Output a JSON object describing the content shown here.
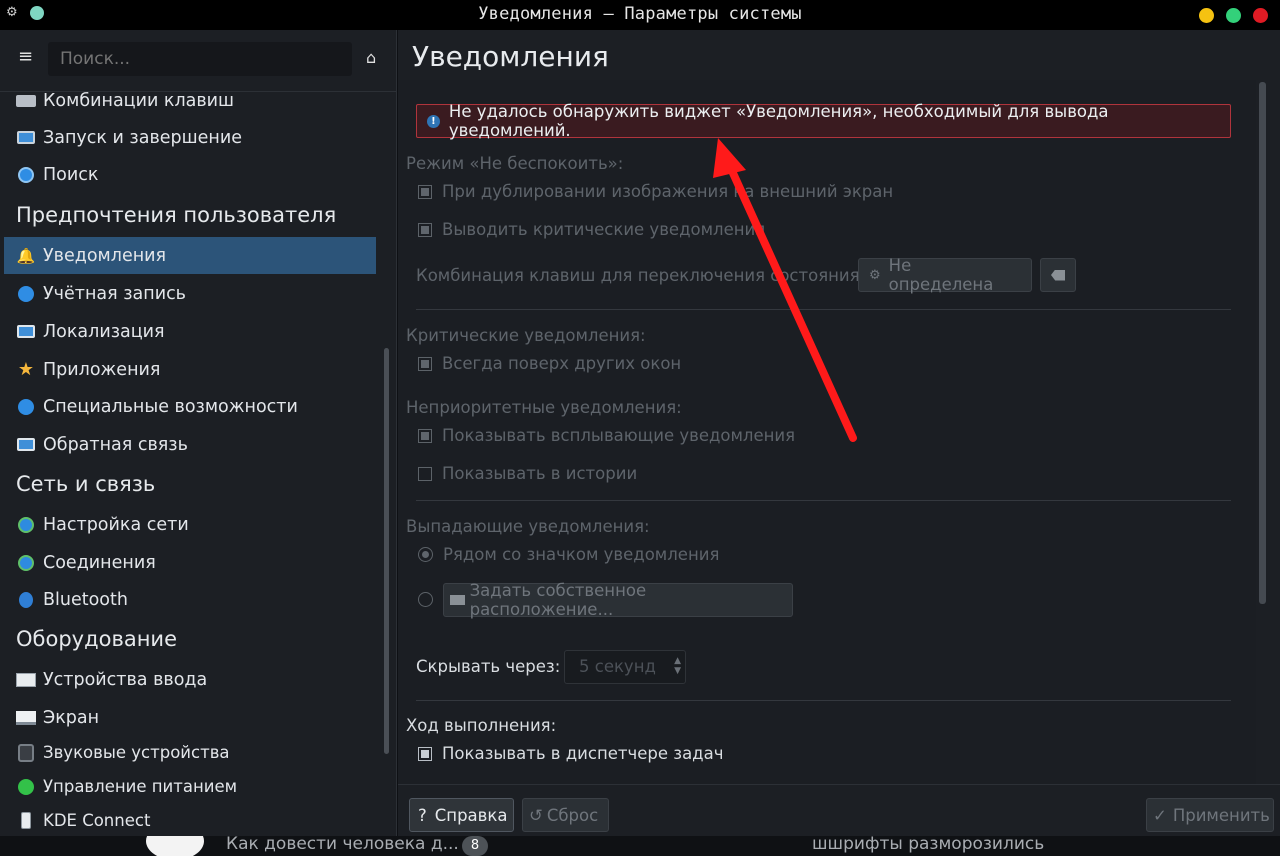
{
  "window": {
    "title": "Уведомления — Параметры системы"
  },
  "sidebar": {
    "search_placeholder": "Поиск...",
    "items": [
      {
        "label": "Комбинации клавиш",
        "icon": "keyboard-icon"
      },
      {
        "label": "Запуск и завершение",
        "icon": "monitor-icon"
      },
      {
        "label": "Поиск",
        "icon": "search-icon"
      }
    ],
    "section_user": "Предпочтения пользователя",
    "user_items": [
      {
        "label": "Уведомления",
        "icon": "bell-icon",
        "active": true
      },
      {
        "label": "Учётная запись",
        "icon": "user-icon"
      },
      {
        "label": "Локализация",
        "icon": "chat-icon"
      },
      {
        "label": "Приложения",
        "icon": "star-icon"
      },
      {
        "label": "Специальные возможности",
        "icon": "accessibility-icon"
      },
      {
        "label": "Обратная связь",
        "icon": "feedback-icon"
      }
    ],
    "section_network": "Сеть и связь",
    "network_items": [
      {
        "label": "Настройка сети",
        "icon": "globe-icon"
      },
      {
        "label": "Соединения",
        "icon": "globe-icon"
      },
      {
        "label": "Bluetooth",
        "icon": "bluetooth-icon"
      }
    ],
    "section_hardware": "Оборудование",
    "hardware_items": [
      {
        "label": "Устройства ввода",
        "icon": "keyboard-device-icon"
      },
      {
        "label": "Экран",
        "icon": "display-icon"
      },
      {
        "label": "Звуковые устройства",
        "icon": "speaker-icon"
      },
      {
        "label": "Управление питанием",
        "icon": "power-icon"
      },
      {
        "label": "KDE Connect",
        "icon": "phone-icon"
      }
    ]
  },
  "main": {
    "title": "Уведомления",
    "error": "Не удалось обнаружить виджет «Уведомления», необходимый для вывода уведомлений.",
    "dnd_label": "Режим «Не беспокоить»:",
    "dnd_mirror": "При дублировании изображения на внешний экран",
    "dnd_critical": "Выводить критические уведомления",
    "shortcut_label": "Комбинация клавиш для переключения состояния:",
    "shortcut_button": "Не определена",
    "critical_label": "Критические уведомления:",
    "critical_on_top": "Всегда поверх других окон",
    "low_label": "Неприоритетные уведомления:",
    "low_popups": "Показывать всплывающие уведомления",
    "low_history": "Показывать в истории",
    "popup_label": "Выпадающие уведомления:",
    "popup_near_icon": "Рядом со значком уведомления",
    "popup_custom": "Задать собственное расположение...",
    "hide_label": "Скрывать через:",
    "hide_value": "5 секунд",
    "progress_label": "Ход выполнения:",
    "progress_taskman": "Показывать в диспетчере задач"
  },
  "footer": {
    "help": "Справка",
    "reset": "Сброс",
    "apply": "Применить"
  },
  "taskbar": {
    "text1": "Как довести человека д...",
    "badge": "8",
    "text2": "шшрифты разморозились"
  },
  "colors": {
    "accent_active": "#2c5479",
    "error_border": "#b0343c",
    "arrow": "#ff1a1a"
  }
}
